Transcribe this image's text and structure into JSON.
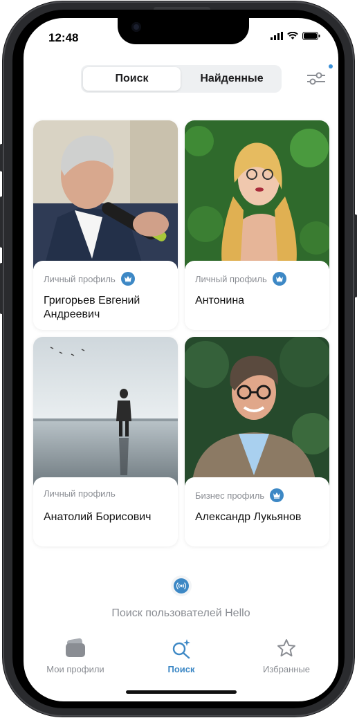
{
  "status": {
    "time": "12:48"
  },
  "segmented": {
    "search": "Поиск",
    "found": "Найденные"
  },
  "profiles": [
    {
      "type": "Личный профиль",
      "name": "Григорьев Евгений Андреевич",
      "premium": true
    },
    {
      "type": "Личный профиль",
      "name": "Антонина",
      "premium": true
    },
    {
      "type": "Личный профиль",
      "name": "Анатолий Борисович",
      "premium": false
    },
    {
      "type": "Бизнес профиль",
      "name": "Александр Лукьянов",
      "premium": true
    }
  ],
  "hello": {
    "text": "Поиск пользователей Hello"
  },
  "tabbar": {
    "profiles": "Мои профили",
    "search": "Поиск",
    "favorites": "Избранные"
  },
  "colors": {
    "accent": "#3d88c5",
    "muted": "#8a8d93"
  }
}
